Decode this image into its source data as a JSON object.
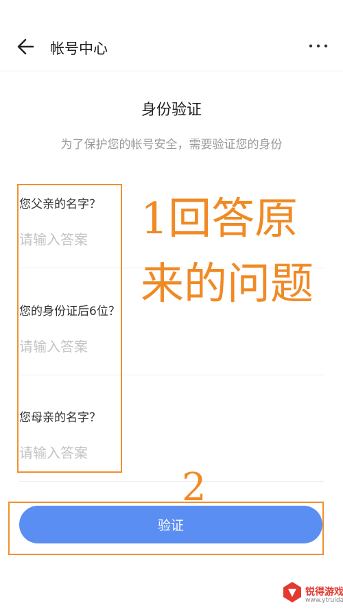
{
  "header": {
    "title": "帐号中心",
    "back_icon": "arrow-left-icon",
    "more_icon": "more-dots-icon"
  },
  "page": {
    "heading": "身份验证",
    "subheading": "为了保护您的帐号安全，需要验证您的身份"
  },
  "questions": [
    {
      "label": "您父亲的名字？",
      "placeholder": "请输入答案",
      "value": ""
    },
    {
      "label": "您的身份证后6位？",
      "placeholder": "请输入答案",
      "value": ""
    },
    {
      "label": "您母亲的名字？",
      "placeholder": "请输入答案",
      "value": ""
    }
  ],
  "verify_button": {
    "label": "验证"
  },
  "annotations": {
    "step1_line1": "1回答原",
    "step1_line2": "来的问题",
    "step2": "2",
    "color": "#f08a25"
  },
  "watermark": {
    "name": "锐得游戏网",
    "url": "www.ytruida.com"
  },
  "colors": {
    "accent": "#5b8ef2",
    "placeholder": "#c4c4c4",
    "annotation": "#f08a25"
  }
}
